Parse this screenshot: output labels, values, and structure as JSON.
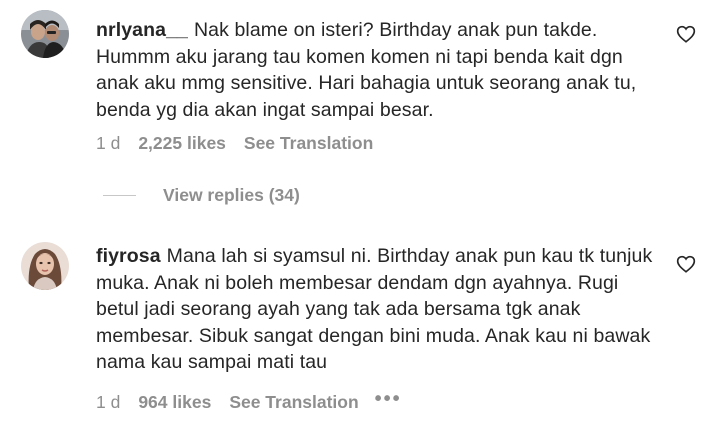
{
  "comments": [
    {
      "username": "nrlyana__",
      "text": "Nak blame on isteri? Birthday anak pun takde. Hummm aku jarang tau komen komen ni tapi benda kait dgn anak aku mmg sensitive. Hari bahagia untuk seorang anak tu, benda yg dia akan ingat sampai besar.",
      "time": "1 d",
      "likes": "2,225 likes",
      "translate": "See Translation",
      "avatar_icon": "profile-photo-icon",
      "like_icon": "heart-outline-icon"
    },
    {
      "username": "fiyrosa",
      "text": "Mana lah si syamsul ni. Birthday anak pun kau tk tunjuk muka. Anak ni boleh membesar dendam dgn ayahnya. Rugi betul jadi seorang ayah yang tak ada bersama tgk anak membesar. Sibuk sangat dengan bini muda. Anak kau ni bawak nama kau sampai mati tau",
      "time": "1 d",
      "likes": "964 likes",
      "translate": "See Translation",
      "more": "•••",
      "avatar_icon": "profile-photo-icon",
      "like_icon": "heart-outline-icon"
    }
  ],
  "replies": {
    "label": "View replies (34)"
  },
  "colors": {
    "text": "#262626",
    "secondary": "#8e8e8e",
    "divider": "#c7c7c7"
  }
}
